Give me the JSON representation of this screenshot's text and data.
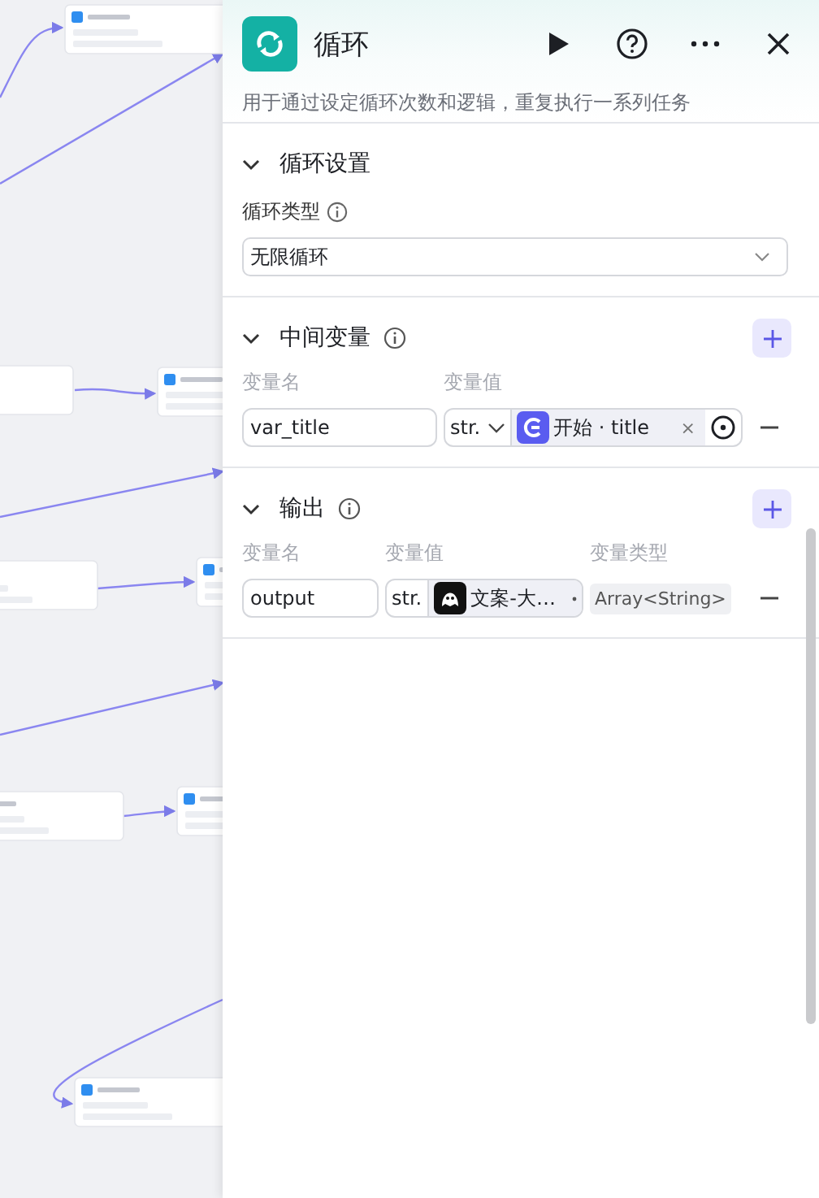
{
  "panel": {
    "title": "循环",
    "description": "用于通过设定循环次数和逻辑，重复执行一系列任务"
  },
  "sections": [
    {
      "kind": "settings",
      "title": "循环设置",
      "expanded": true,
      "field_label": "循环类型",
      "field_info": true,
      "select_value": "无限循环"
    },
    {
      "kind": "variables",
      "title": "中间变量",
      "expanded": true,
      "info": true,
      "columns": [
        "变量名",
        "变量值"
      ],
      "rows": [
        {
          "name": "var_title",
          "value_type": "str.",
          "kind": "start",
          "ref": "开始 · title",
          "clear": "×"
        }
      ]
    },
    {
      "kind": "variables",
      "title": "输出",
      "expanded": true,
      "info": true,
      "columns": [
        "变量名",
        "变量值",
        "变量类型"
      ],
      "rows": [
        {
          "name": "output",
          "value_type": "str.",
          "kind": "bot",
          "ref": "文案-大…",
          "type": "Array<String>"
        }
      ]
    }
  ]
}
